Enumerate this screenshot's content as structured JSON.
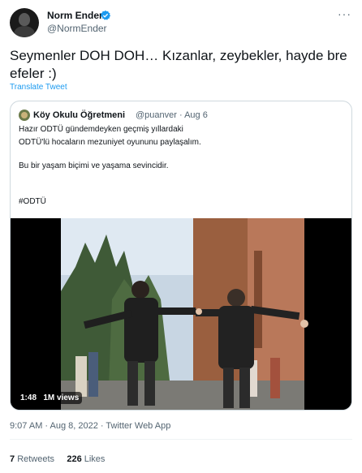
{
  "author": {
    "name": "Norm Ender",
    "handle": "@NormEnder"
  },
  "tweet": {
    "text": "Seymenler DOH DOH… Kızanlar, zeybekler, hayde bre efeler :)",
    "translate_label": "Translate Tweet"
  },
  "quoted": {
    "name": "Köy Okulu Öğretmeni",
    "handle_date": "@puanver · Aug 6",
    "lines": [
      "Hazır ODTÜ gündemdeyken geçmiş yıllardaki",
      "ODTÜ'lü hocaların mezuniyet oyununu paylaşalım.",
      "Bu bir yaşam biçimi ve yaşama sevincidir.",
      "#ODTÜ"
    ],
    "video": {
      "duration": "1:48",
      "views": "1M views"
    }
  },
  "meta": {
    "timestamp": "9:07 AM · Aug 8, 2022 · Twitter Web App"
  },
  "stats": {
    "retweets_count": "7",
    "retweets_label": "Retweets",
    "likes_count": "226",
    "likes_label": "Likes"
  },
  "icons": {
    "verified": "verified-badge-icon",
    "more": "more-icon"
  },
  "colors": {
    "accent": "#1d9bf0",
    "secondary_text": "#536471",
    "primary_text": "#0f1419",
    "border": "#cfd9de"
  }
}
